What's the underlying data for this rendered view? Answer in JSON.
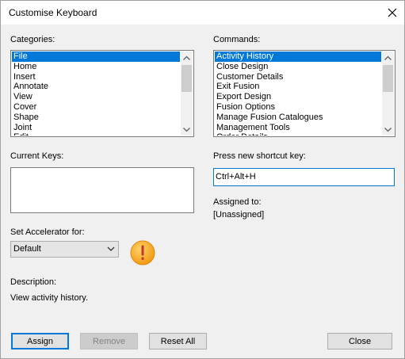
{
  "window": {
    "title": "Customise Keyboard"
  },
  "categories": {
    "label": "Categories:",
    "items": [
      "File",
      "Home",
      "Insert",
      "Annotate",
      "View",
      "Cover",
      "Shape",
      "Joint",
      "Edit"
    ],
    "selected_index": 0
  },
  "commands": {
    "label": "Commands:",
    "items": [
      "Activity History",
      "Close Design",
      "Customer Details",
      "Exit Fusion",
      "Export Design",
      "Fusion Options",
      "Manage Fusion Catalogues",
      "Management Tools",
      "Order Details"
    ],
    "selected_index": 0
  },
  "current_keys": {
    "label": "Current Keys:",
    "value": ""
  },
  "shortcut": {
    "label": "Press new shortcut key:",
    "value": "Ctrl+Alt+H"
  },
  "assigned": {
    "label": "Assigned to:",
    "value": "[Unassigned]"
  },
  "accelerator": {
    "label": "Set Accelerator for:",
    "selected": "Default"
  },
  "description": {
    "label": "Description:",
    "value": "View activity history."
  },
  "buttons": {
    "assign": "Assign",
    "remove": "Remove",
    "reset_all": "Reset All",
    "close": "Close"
  },
  "colors": {
    "selection": "#0078d7",
    "warning": "#f5a623"
  }
}
